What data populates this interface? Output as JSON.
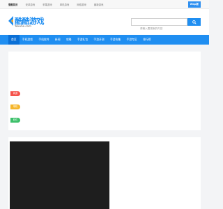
{
  "topbar": {
    "links": [
      "壹酷首页",
      "安卓游戏",
      "苹果游戏",
      "单机游戏",
      "网络游戏",
      "最新游戏"
    ],
    "mobile_label": "Wap版"
  },
  "logo": {
    "name": "酷酷游戏",
    "url": "Yokuhe.com",
    "color": "#1f8ef1"
  },
  "search": {
    "placeholder": "请输入要搜索的内容"
  },
  "nav": {
    "items": [
      "首页",
      "手机游戏",
      "手机软件",
      "新闻",
      "攻略",
      "手游礼包",
      "手游开测",
      "手游合集",
      "手游专区",
      "排行榜"
    ]
  },
  "tags": [
    {
      "label": "网游",
      "color": "#f5534b"
    },
    {
      "label": "单机",
      "color": "#f5b62c"
    },
    {
      "label": "软件",
      "color": "#3cc06a"
    }
  ],
  "colors": {
    "accent": "#1f8ef1",
    "nav_active": "#0a6fd6"
  }
}
